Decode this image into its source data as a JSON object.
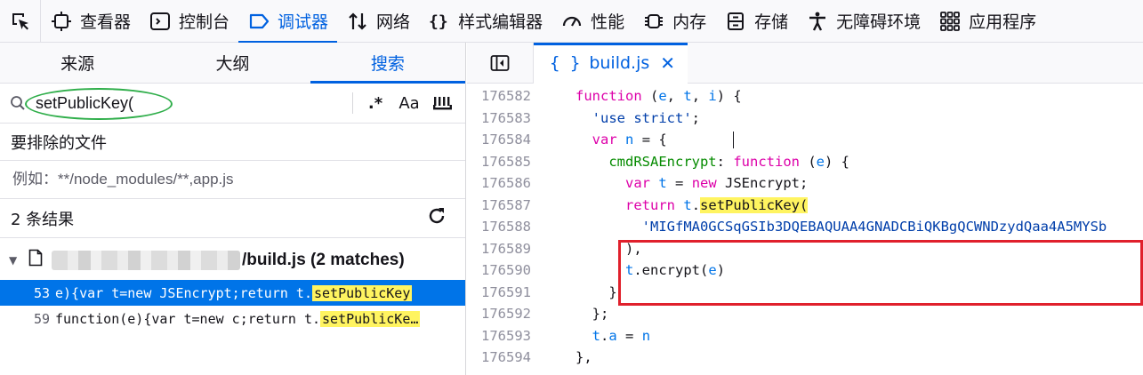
{
  "toolbar": {
    "tabs": [
      {
        "label": "查看器",
        "icon": "inspector-icon"
      },
      {
        "label": "控制台",
        "icon": "console-icon"
      },
      {
        "label": "调试器",
        "icon": "debugger-icon",
        "active": true
      },
      {
        "label": "网络",
        "icon": "network-icon"
      },
      {
        "label": "样式编辑器",
        "icon": "style-editor-icon"
      },
      {
        "label": "性能",
        "icon": "performance-icon"
      },
      {
        "label": "内存",
        "icon": "memory-icon"
      },
      {
        "label": "存储",
        "icon": "storage-icon"
      },
      {
        "label": "无障碍环境",
        "icon": "accessibility-icon"
      },
      {
        "label": "应用程序",
        "icon": "application-icon"
      }
    ]
  },
  "left": {
    "tabs": [
      "来源",
      "大纲",
      "搜索"
    ],
    "search": {
      "value": "setPublicKey(",
      "regex_label": ".*",
      "case_label": "Aa",
      "whole_word_label": "\"\"\""
    },
    "exclude_label": "要排除的文件",
    "exclude_placeholder": "例如：**/node_modules/**,app.js",
    "result_count": "2 条结果",
    "file": {
      "name": "/build.js (2 matches)"
    },
    "matches": [
      {
        "line": "53",
        "before": "e){var t=new JSEncrypt;return t.",
        "highlight": "setPublicKey"
      },
      {
        "line": "59",
        "before": "function(e){var t=new c;return t.",
        "highlight": "setPublicKe…"
      }
    ]
  },
  "right": {
    "tab_label": "build.js",
    "tab_braces": "{ }",
    "lines": [
      {
        "n": "176582",
        "html": "<span class=\"kw\">function</span> (<span class=\"var\">e</span>, <span class=\"var\">t</span>, <span class=\"var\">i</span>) {"
      },
      {
        "n": "176583",
        "html": "  <span class=\"str2\">'use strict'</span>;"
      },
      {
        "n": "176584",
        "html": "  <span class=\"kw\">var</span> <span class=\"var\">n</span> = {"
      },
      {
        "n": "176585",
        "html": "    <span class=\"prop\">cmdRSAEncrypt</span>: <span class=\"kw\">function</span> (<span class=\"var\">e</span>) {"
      },
      {
        "n": "176586",
        "html": "      <span class=\"kw\">var</span> <span class=\"var\">t</span> = <span class=\"kw\">new</span> JSEncrypt;"
      },
      {
        "n": "176587",
        "html": "      <span class=\"kw\">return</span> <span class=\"var\">t</span>.<span class=\"fn-hl\">setPublicKey(</span>"
      },
      {
        "n": "176588",
        "html": "        <span class=\"str2\">'MIGfMA0GCSqGSIb3DQEBAQUAA4GNADCBiQKBgQCWNDzydQaa4A5MYSb</span>"
      },
      {
        "n": "176589",
        "html": "      ),"
      },
      {
        "n": "176590",
        "html": "      <span class=\"var\">t</span>.encrypt(<span class=\"var\">e</span>)"
      },
      {
        "n": "176591",
        "html": "    }"
      },
      {
        "n": "176592",
        "html": "  };"
      },
      {
        "n": "176593",
        "html": "  <span class=\"var\">t</span>.<span class=\"var\">a</span> = <span class=\"var\">n</span>"
      },
      {
        "n": "176594",
        "html": "},"
      }
    ]
  },
  "colors": {
    "accent": "#0061e0",
    "annotation_red": "#e0202c",
    "annotation_green": "#2fae4a",
    "match_highlight": "#fff460",
    "selected_row": "#0074e8"
  }
}
